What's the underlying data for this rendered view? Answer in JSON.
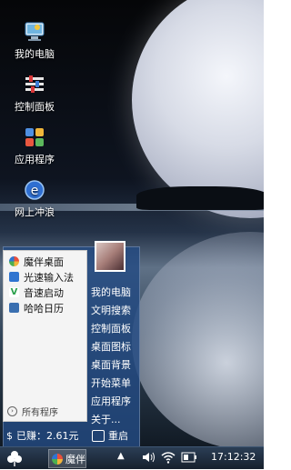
{
  "desktop": {
    "icons": [
      {
        "label": "我的电脑",
        "icon": "computer-icon"
      },
      {
        "label": "控制面板",
        "icon": "control-panel-icon"
      },
      {
        "label": "应用程序",
        "icon": "applications-icon"
      },
      {
        "label": "网上冲浪",
        "icon": "browser-icon"
      }
    ]
  },
  "start_menu": {
    "items": [
      {
        "label": "魔伴桌面",
        "icon": "mobanbox-icon",
        "color": "#e94f3c"
      },
      {
        "label": "光速输入法",
        "icon": "input-method-icon",
        "color": "#2f74d0"
      },
      {
        "label": "音速启动",
        "icon": "vstart-icon",
        "color": "#2aa04a"
      },
      {
        "label": "哈哈日历",
        "icon": "calendar-icon",
        "color": "#3a6fb0"
      }
    ],
    "all_programs": "所有程序",
    "right_items": [
      "我的电脑",
      "文明搜索",
      "控制面板",
      "桌面图标",
      "桌面背景",
      "开始菜单",
      "应用程序",
      "关于..."
    ],
    "earnings": "已赚：2.61元",
    "restart": "重启"
  },
  "taskbar": {
    "app_label": "魔伴",
    "clock": "17:12:32"
  }
}
